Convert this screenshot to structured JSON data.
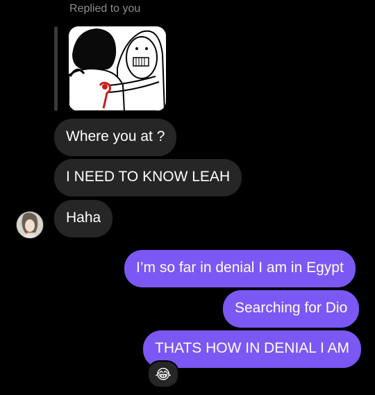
{
  "thread": {
    "replied_label": "Replied to you",
    "reply_image": "meme-image"
  },
  "messages": [
    {
      "from": "them",
      "text": "Where you at ?"
    },
    {
      "from": "them",
      "text": "I NEED TO KNOW LEAH"
    },
    {
      "from": "them",
      "text": "Haha"
    },
    {
      "from": "me",
      "text": "I’m so far in denial I am in Egypt"
    },
    {
      "from": "me",
      "text": "Searching for Dio"
    },
    {
      "from": "me",
      "text": "THATS HOW IN DENIAL I AM"
    }
  ],
  "reaction": {
    "emoji": "😂",
    "icon": "laughing-crying-emoji-icon"
  },
  "colors": {
    "incoming_bubble": "#262626",
    "outgoing_bubble": "#7b58f4",
    "background": "#000000"
  }
}
